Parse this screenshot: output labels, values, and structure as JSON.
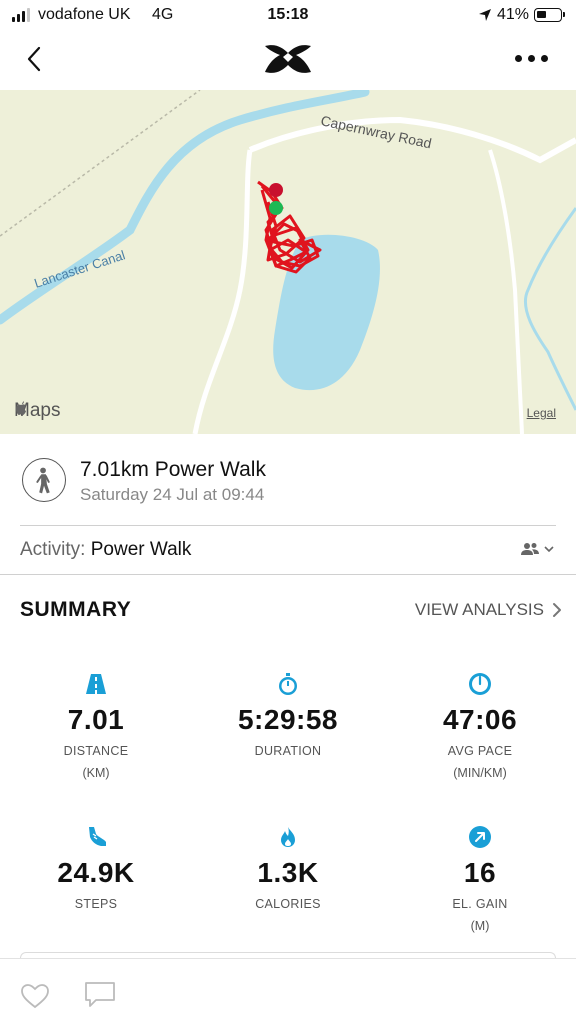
{
  "status_bar": {
    "carrier": "vodafone UK",
    "network": "4G",
    "time": "15:18",
    "battery": "41%",
    "battery_level": 0.41
  },
  "nav": {
    "logo": "under-armour-logo",
    "back_icon": "chevron-left-icon",
    "more_icon": "more-dots-icon"
  },
  "map": {
    "road_label": "Capernwray Road",
    "canal_label": "Lancaster Canal",
    "maps_label": "Maps",
    "legal_label": "Legal",
    "colors": {
      "land": "#eef0d9",
      "water": "#a8dbeb",
      "route": "#e0141e",
      "start": "#1db954",
      "finish": "#c8102e"
    }
  },
  "activity": {
    "title": "7.01km Power Walk",
    "date": "Saturday 24 Jul at 09:44",
    "type_label": "Activity:",
    "type_value": "Power Walk",
    "icon": "walker-icon",
    "privacy_icon": "friends-icon"
  },
  "summary": {
    "title": "SUMMARY",
    "view_analysis": "VIEW ANALYSIS",
    "accent_color": "#1a9fd6",
    "stats": [
      {
        "icon": "road-icon",
        "value": "7.01",
        "label": "DISTANCE",
        "unit": "(KM)"
      },
      {
        "icon": "stopwatch-icon",
        "value": "5:29:58",
        "label": "DURATION",
        "unit": ""
      },
      {
        "icon": "pace-gauge-icon",
        "value": "47:06",
        "label": "AVG PACE",
        "unit": "(MIN/KM)"
      },
      {
        "icon": "shoe-icon",
        "value": "24.9K",
        "label": "STEPS",
        "unit": ""
      },
      {
        "icon": "flame-icon",
        "value": "1.3K",
        "label": "CALORIES",
        "unit": ""
      },
      {
        "icon": "elevation-arrow-icon",
        "value": "16",
        "label": "EL. GAIN",
        "unit": "(M)"
      }
    ]
  },
  "bottom_bar": {
    "like_icon": "heart-icon",
    "comment_icon": "comment-icon"
  }
}
